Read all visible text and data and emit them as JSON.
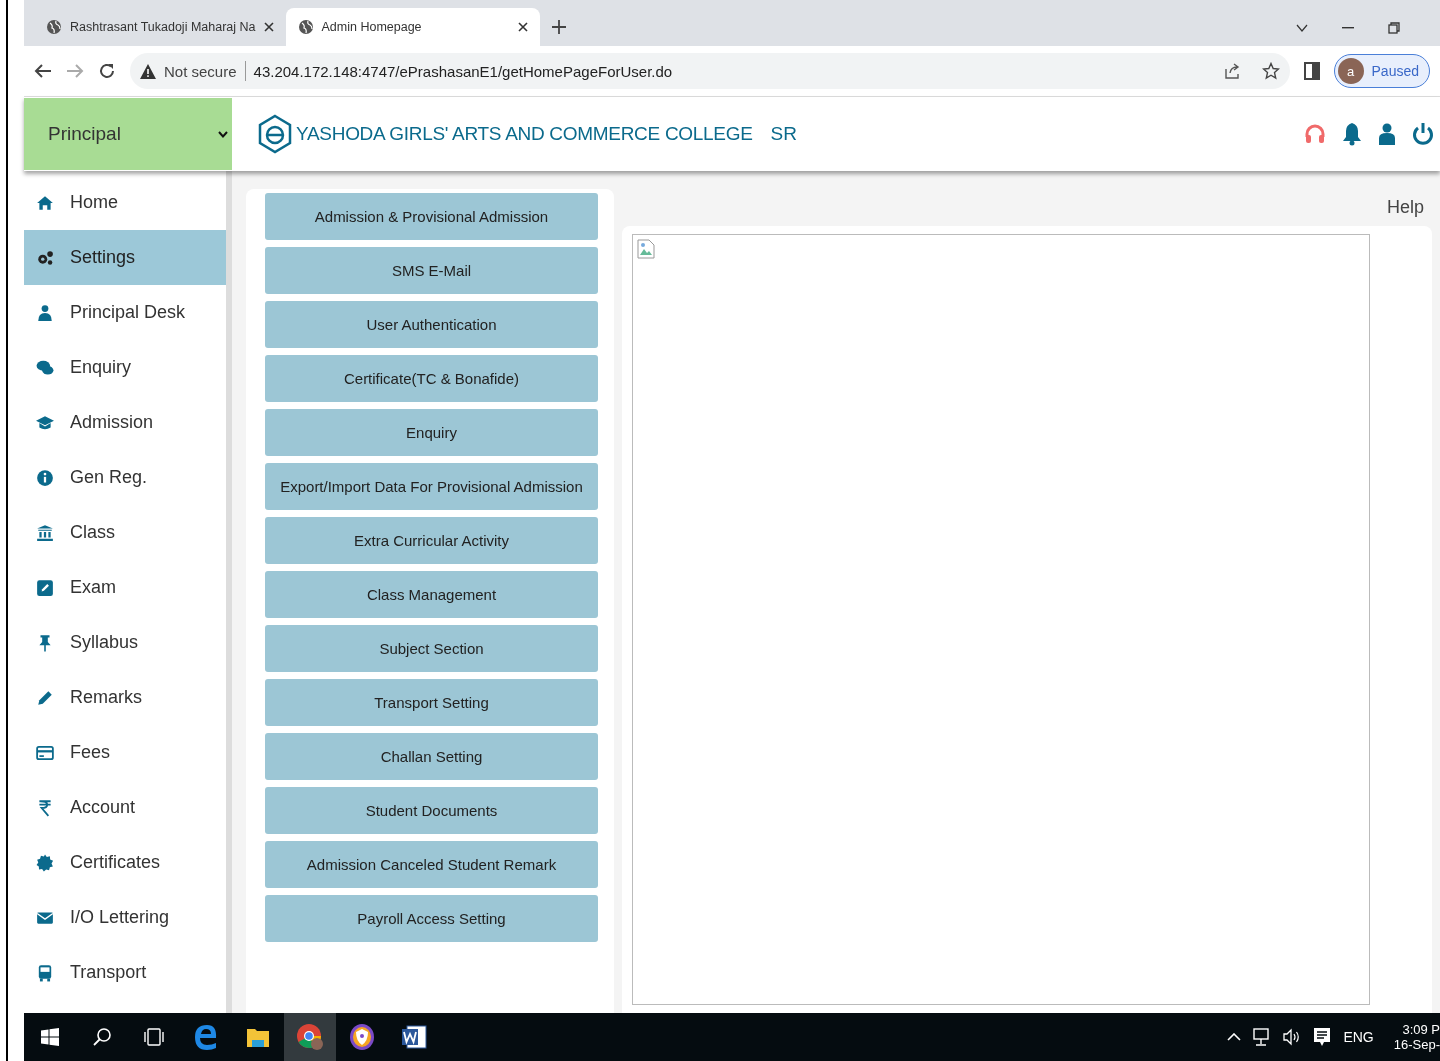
{
  "browser": {
    "tabs": [
      {
        "title": "Rashtrasant Tukadoji Maharaj Na",
        "selected": false
      },
      {
        "title": "Admin Homepage",
        "selected": true
      }
    ],
    "security_label": "Not secure",
    "url": "43.204.172.148:4747/ePrashasanE1/getHomePageForUser.do",
    "profile_initial": "a",
    "profile_status": "Paused"
  },
  "header": {
    "role": "Principal",
    "college": "YASHODA GIRLS' ARTS AND COMMERCE COLLEGE",
    "code": "SR"
  },
  "sidebar": {
    "items": [
      {
        "label": "Home",
        "selected": false
      },
      {
        "label": "Settings",
        "selected": true
      },
      {
        "label": "Principal Desk",
        "selected": false
      },
      {
        "label": "Enquiry",
        "selected": false
      },
      {
        "label": "Admission",
        "selected": false
      },
      {
        "label": "Gen Reg.",
        "selected": false
      },
      {
        "label": "Class",
        "selected": false
      },
      {
        "label": "Exam",
        "selected": false
      },
      {
        "label": "Syllabus",
        "selected": false
      },
      {
        "label": "Remarks",
        "selected": false
      },
      {
        "label": "Fees",
        "selected": false
      },
      {
        "label": "Account",
        "selected": false
      },
      {
        "label": "Certificates",
        "selected": false
      },
      {
        "label": "I/O Lettering",
        "selected": false
      },
      {
        "label": "Transport",
        "selected": false
      }
    ]
  },
  "help": "Help",
  "settings_menu": [
    "Admission & Provisional Admission",
    "SMS E-Mail",
    "User Authentication",
    "Certificate(TC & Bonafide)",
    "Enquiry",
    "Export/Import Data For Provisional Admission",
    "Extra Curricular Activity",
    "Class Management",
    "Subject Section",
    "Transport Setting",
    "Challan Setting",
    "Student Documents",
    "Admission Canceled Student Remark",
    "Payroll Access Setting"
  ],
  "taskbar": {
    "language": "ENG",
    "time": "3:09 P",
    "date": "16-Sep-"
  }
}
